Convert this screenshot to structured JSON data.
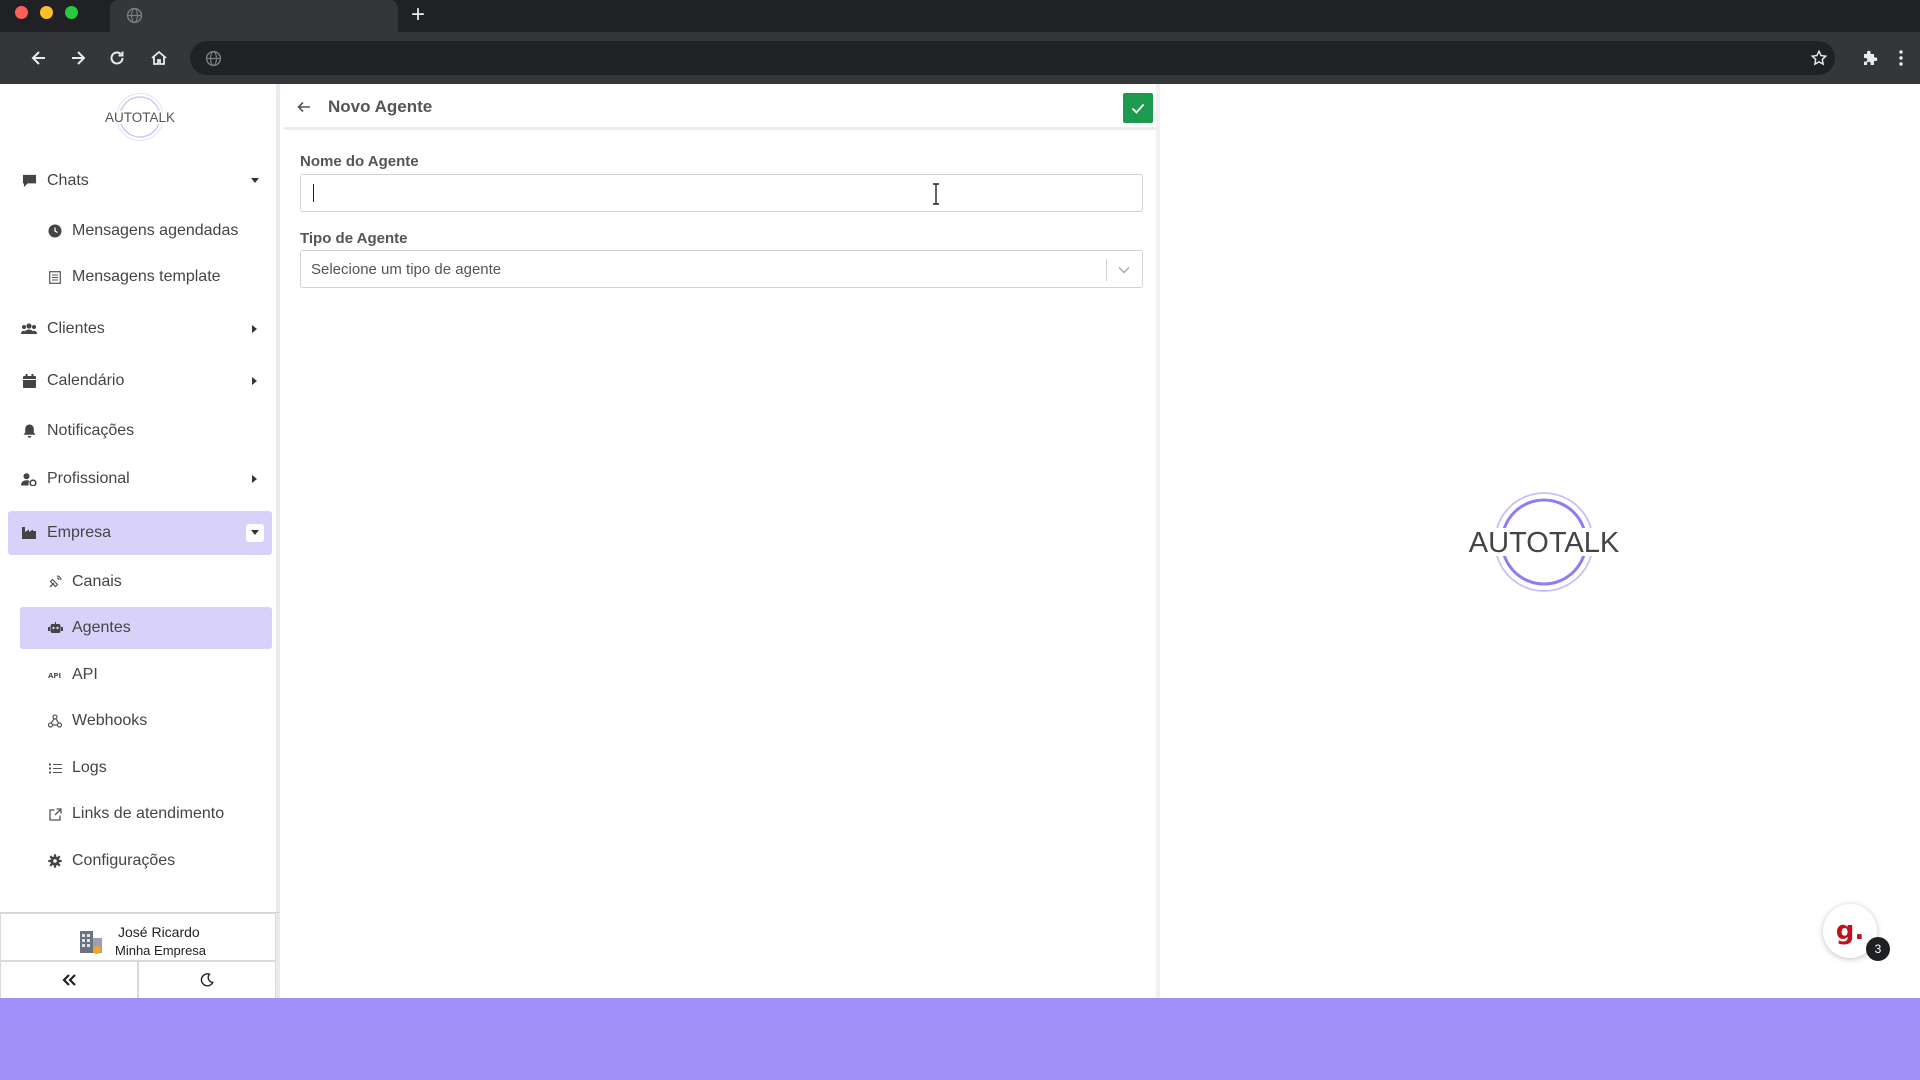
{
  "browser": {
    "new_tab_label": "+"
  },
  "brand": {
    "logo_text": "AUTOTALK",
    "accent": "#d8d2fb",
    "logo_ring_color": "#8c7ef0",
    "confirm_color": "#1e9a4e",
    "band_color": "#a090f8"
  },
  "sidebar": {
    "items": [
      {
        "label": "Chats",
        "icon": "chat-bubble-icon",
        "caret": "down"
      },
      {
        "label": "Mensagens agendadas",
        "icon": "clock-icon",
        "sub": true
      },
      {
        "label": "Mensagens template",
        "icon": "template-icon",
        "sub": true
      },
      {
        "label": "Clientes",
        "icon": "users-icon",
        "caret": "right"
      },
      {
        "label": "Calendário",
        "icon": "calendar-icon",
        "caret": "right"
      },
      {
        "label": "Notificações",
        "icon": "bell-icon"
      },
      {
        "label": "Profissional",
        "icon": "user-gear-icon",
        "caret": "right"
      },
      {
        "label": "Empresa",
        "icon": "building-icon",
        "caret": "down",
        "active": true
      },
      {
        "label": "Canais",
        "icon": "satellite-icon",
        "sub": true
      },
      {
        "label": "Agentes",
        "icon": "robot-icon",
        "sub": true,
        "active": true
      },
      {
        "label": "API",
        "icon": "api-icon",
        "sub": true
      },
      {
        "label": "Webhooks",
        "icon": "webhook-icon",
        "sub": true
      },
      {
        "label": "Logs",
        "icon": "list-icon",
        "sub": true
      },
      {
        "label": "Links de atendimento",
        "icon": "external-link-icon",
        "sub": true
      },
      {
        "label": "Configurações",
        "icon": "gear-icon",
        "sub": true
      }
    ]
  },
  "user": {
    "name": "José Ricardo",
    "company": "Minha Empresa"
  },
  "panel": {
    "title": "Novo Agente",
    "name_label": "Nome do Agente",
    "name_value": "",
    "type_label": "Tipo de Agente",
    "type_placeholder": "Selecione um tipo de agente"
  },
  "chat_widget": {
    "letter": "g.",
    "badge": "3"
  }
}
